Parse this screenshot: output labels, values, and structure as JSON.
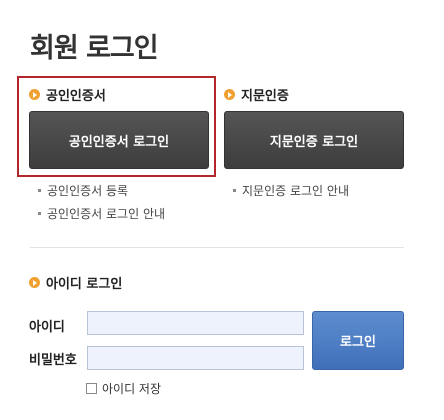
{
  "page_title": "회원 로그인",
  "cert": {
    "heading": "공인인증서",
    "button_label": "공인인증서 로그인",
    "links": [
      "공인인증서 등록",
      "공인인증서 로그인 안내"
    ]
  },
  "fingerprint": {
    "heading": "지문인증",
    "button_label": "지문인증 로그인",
    "links": [
      "지문인증 로그인 안내"
    ]
  },
  "id_login": {
    "heading": "아이디 로그인",
    "id_label": "아이디",
    "id_value": "",
    "password_label": "비밀번호",
    "password_value": "",
    "login_button": "로그인",
    "save_id_label": "아이디 저장",
    "save_id_checked": false
  },
  "colors": {
    "highlight_border": "#b3262c",
    "bullet": "#f0a030",
    "dark_button": "#454545",
    "login_button": "#4a7cc4",
    "field_bg": "#eef2fc"
  },
  "icons": {
    "section_bullet": "orange-circle-arrow-icon",
    "checkbox": "checkbox-icon"
  }
}
